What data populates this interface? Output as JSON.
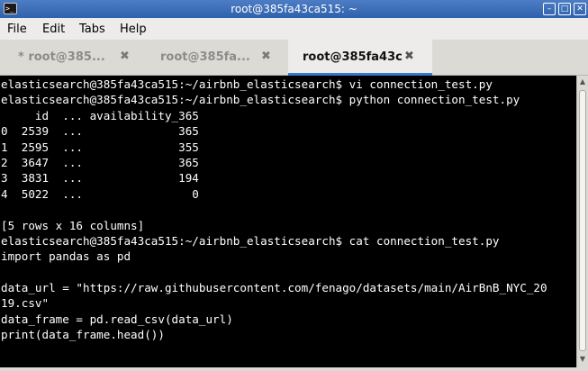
{
  "window": {
    "title": "root@385fa43ca515: ~",
    "icon_glyph": ">_",
    "minimize_glyph": "–",
    "maximize_glyph": "□",
    "close_glyph": "✕"
  },
  "menu": {
    "file": "File",
    "edit": "Edit",
    "tabs": "Tabs",
    "help": "Help"
  },
  "tabs": [
    {
      "label": "* root@385...",
      "close": "✖"
    },
    {
      "label": "root@385fa...",
      "close": "✖"
    },
    {
      "label": "root@385fa43c",
      "close": "✖"
    }
  ],
  "terminal": {
    "lines": [
      "elasticsearch@385fa43ca515:~/airbnb_elasticsearch$ vi connection_test.py",
      "elasticsearch@385fa43ca515:~/airbnb_elasticsearch$ python connection_test.py",
      "     id  ... availability_365",
      "0  2539  ...              365",
      "1  2595  ...              355",
      "2  3647  ...              365",
      "3  3831  ...              194",
      "4  5022  ...                0",
      "",
      "[5 rows x 16 columns]",
      "elasticsearch@385fa43ca515:~/airbnb_elasticsearch$ cat connection_test.py",
      "import pandas as pd",
      "",
      "data_url = \"https://raw.githubusercontent.com/fenago/datasets/main/AirBnB_NYC_20",
      "19.csv\"",
      "data_frame = pd.read_csv(data_url)",
      "print(data_frame.head())"
    ]
  },
  "scrollbar": {
    "up_glyph": "▲",
    "down_glyph": "▼"
  }
}
